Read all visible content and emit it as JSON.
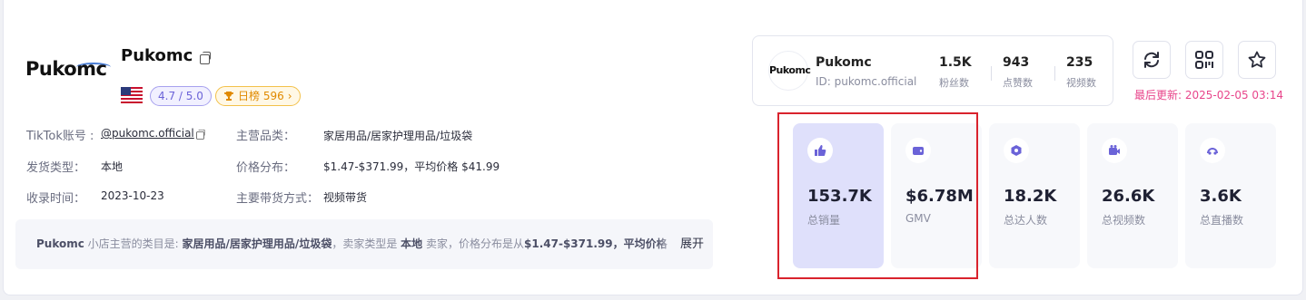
{
  "store": {
    "name": "Pukomc",
    "logo_text": "Pukomc",
    "rating": "4.7 / 5.0",
    "rank": "日榜 596",
    "rank_arrow": "›"
  },
  "info": {
    "tiktok_label": "TikTok账号 :",
    "tiktok_value": "@pukomc.official",
    "ship_label": "发货类型：",
    "ship_value": "本地",
    "since_label": "收录时间：",
    "since_value": "2023-10-23",
    "category_label": "主营品类：",
    "category_value": "家居用品/居家护理用品/垃圾袋",
    "price_label": "价格分布：",
    "price_value": "$1.47-$371.99，平均价格 $41.99",
    "mode_label": "主要带货方式：",
    "mode_value": "视频带货"
  },
  "description": {
    "store": "Pukomc",
    "t1": " 小店主营的类目是: ",
    "category": "家居用品/居家护理用品/垃圾袋",
    "t2": "，卖家类型是 ",
    "ship": "本地",
    "t3": " 卖家，价格分布是从",
    "range": "$1.47-$371.99，平均价格",
    "expand": "展开"
  },
  "profile": {
    "avatar_text": "Pukomc",
    "name": "Pukomc",
    "id": "ID: pukomc.official",
    "stats": [
      {
        "value": "1.5K",
        "label": "粉丝数"
      },
      {
        "value": "943",
        "label": "点赞数"
      },
      {
        "value": "235",
        "label": "视频数"
      }
    ]
  },
  "last_update": "最后更新: 2025-02-05 03:14",
  "tiles": [
    {
      "value": "153.7K",
      "label": "总销量",
      "icon": "thumbs-up-icon"
    },
    {
      "value": "$6.78M",
      "label": "GMV",
      "icon": "wallet-icon"
    },
    {
      "value": "18.2K",
      "label": "总达人数",
      "icon": "creator-icon"
    },
    {
      "value": "26.6K",
      "label": "总视频数",
      "icon": "video-icon"
    },
    {
      "value": "3.6K",
      "label": "总直播数",
      "icon": "live-icon"
    }
  ],
  "colors": {
    "accent": "#6b63d8",
    "highlight": "#d9232d",
    "update": "#e8458b",
    "rank": "#e08a00"
  }
}
